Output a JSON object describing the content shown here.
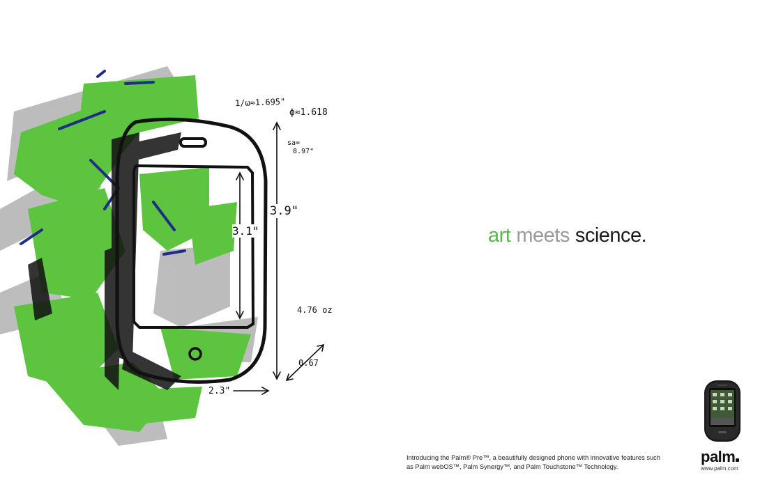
{
  "sketch": {
    "annotations": {
      "omega": "1/ω≈1.695\"",
      "phi": "ϕ≈1.618",
      "sa_label": "sa=",
      "sa_value": "8.97\"",
      "height": "3.9\"",
      "screen": "3.1\"",
      "weight": "4.76 oz",
      "depth": "0.67",
      "width": "2.3\""
    },
    "colors": {
      "paint_green": "#5cc43f",
      "paint_grey": "#b8b8b8",
      "paint_blue": "#1f2d86",
      "ink": "#111111"
    }
  },
  "headline": {
    "word1": "art",
    "word2": "meets",
    "word3": "science.",
    "colors": {
      "word1": "#58b847",
      "word2": "#9a9a9a",
      "word3": "#1a1a1a"
    }
  },
  "body_copy": {
    "line1": "Introducing the Palm® Pre™, a beautifully designed phone with innovative features such",
    "line2": "as Palm webOS™, Palm Synergy™, and Palm Touchstone™ Technology."
  },
  "brand": {
    "logo": "palm",
    "url": "www.palm.com"
  }
}
